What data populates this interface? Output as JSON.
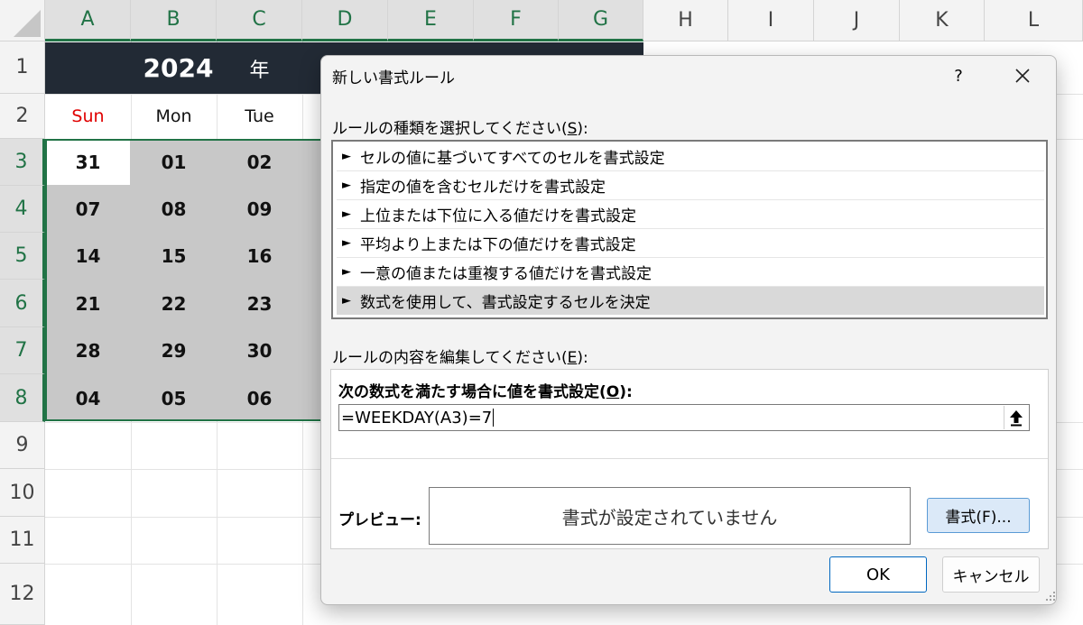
{
  "sheet": {
    "columns": [
      "A",
      "B",
      "C",
      "D",
      "E",
      "F",
      "G",
      "H",
      "I",
      "J",
      "K",
      "L"
    ],
    "rows": [
      "1",
      "2",
      "3",
      "4",
      "5",
      "6",
      "7",
      "8",
      "9",
      "10",
      "11",
      "12"
    ],
    "year": "2024",
    "year_suffix": "年",
    "weekdays": [
      "Sun",
      "Mon",
      "Tue"
    ],
    "dates": [
      [
        "31",
        "01",
        "02"
      ],
      [
        "07",
        "08",
        "09"
      ],
      [
        "14",
        "15",
        "16"
      ],
      [
        "21",
        "22",
        "23"
      ],
      [
        "28",
        "29",
        "30"
      ],
      [
        "04",
        "05",
        "06"
      ]
    ]
  },
  "dialog": {
    "title": "新しい書式ルール",
    "help": "?",
    "close": "✕",
    "rule_type_label": "ルールの種類を選択してください(",
    "rule_type_key": "S",
    "rule_type_end": "):",
    "rule_types": [
      "セルの値に基づいてすべてのセルを書式設定",
      "指定の値を含むセルだけを書式設定",
      "上位または下位に入る値だけを書式設定",
      "平均より上または下の値だけを書式設定",
      "一意の値または重複する値だけを書式設定",
      "数式を使用して、書式設定するセルを決定"
    ],
    "bullet": "►",
    "edit_label": "ルールの内容を編集してください(",
    "edit_key": "E",
    "edit_end": "):",
    "formula_label": "次の数式を満たす場合に値を書式設定(",
    "formula_key": "O",
    "formula_end": "):",
    "formula_value": "=WEEKDAY(A3)=7",
    "preview_label": "プレビュー:",
    "preview_text": "書式が設定されていません",
    "format_button": "書式(F)...",
    "ok_button": "OK",
    "cancel_button": "キャンセル"
  },
  "colors": {
    "banner": "#222a35",
    "sunday_red": "#e00000",
    "excel_green": "#217346",
    "selection_fill": "#c8c8c8",
    "format_button_bg": "#dbe9f8"
  }
}
